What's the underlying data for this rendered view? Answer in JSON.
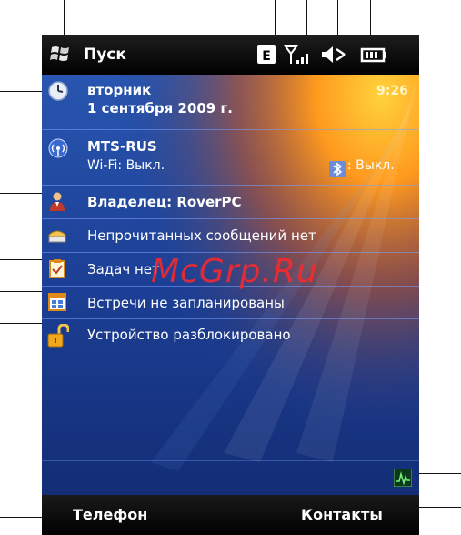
{
  "titlebar": {
    "title": "Пуск"
  },
  "status_icons": [
    "edge-data-icon",
    "signal-strength-icon",
    "volume-muted-icon",
    "battery-icon"
  ],
  "date": {
    "day": "вторник",
    "full_date": "1 сентября 2009 г.",
    "time": "9:26"
  },
  "network": {
    "operator": "MTS-RUS",
    "wifi": "Wi-Fi: Выкл.",
    "bluetooth": ": Выкл."
  },
  "owner": {
    "text": "Владелец: RoverPC"
  },
  "messages": {
    "text": "Непрочитанных сообщений нет"
  },
  "tasks": {
    "text": "Задач нет"
  },
  "calendar": {
    "text": "Встречи не запланированы"
  },
  "lock": {
    "text": "Устройство разблокировано"
  },
  "softkeys": {
    "left": "Телефон",
    "right": "Контакты"
  },
  "watermark": {
    "text": "McGrp.Ru"
  },
  "colors": {
    "accent": "#ff9a1e",
    "background": "#1a2f7a",
    "bars": "#000000"
  }
}
